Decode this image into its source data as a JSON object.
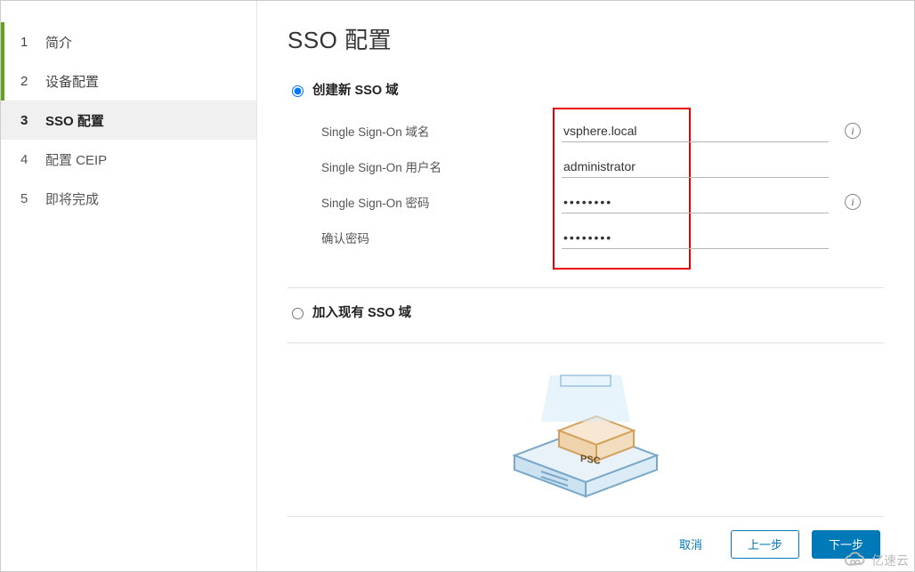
{
  "sidebar": {
    "steps": [
      {
        "num": "1",
        "label": "简介",
        "state": "completed"
      },
      {
        "num": "2",
        "label": "设备配置",
        "state": "completed"
      },
      {
        "num": "3",
        "label": "SSO 配置",
        "state": "active"
      },
      {
        "num": "4",
        "label": "配置 CEIP",
        "state": ""
      },
      {
        "num": "5",
        "label": "即将完成",
        "state": ""
      }
    ]
  },
  "page": {
    "title": "SSO 配置"
  },
  "options": {
    "create": "创建新 SSO 域",
    "join": "加入现有 SSO 域"
  },
  "form": {
    "domain_label": "Single Sign-On 域名",
    "domain_value": "vsphere.local",
    "user_label": "Single Sign-On 用户名",
    "user_value": "administrator",
    "pwd_label": "Single Sign-On 密码",
    "pwd_value": "••••••••",
    "confirm_label": "确认密码",
    "confirm_value": "••••••••"
  },
  "footer": {
    "cancel": "取消",
    "prev": "上一步",
    "next": "下一步"
  },
  "watermark": "亿速云",
  "info_glyph": "i"
}
